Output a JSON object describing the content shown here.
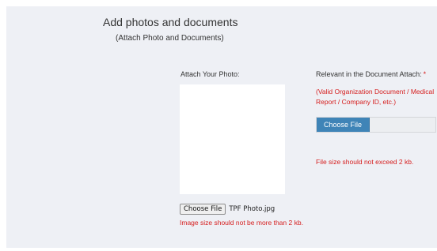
{
  "header": {
    "title": "Add photos and documents",
    "subtitle": "(Attach Photo and Documents)"
  },
  "photo": {
    "label": "Attach Your Photo:",
    "choose_button": "Choose File",
    "file_name": "TPF Photo.jpg",
    "size_error": "Image size should not be more than 2 kb."
  },
  "document": {
    "label": "Relevant in the Document Attach:",
    "required_marker": "*",
    "hint": "(Valid Organization Document / Medical Report / Company ID, etc.)",
    "choose_button": "Choose File",
    "size_error": "File size should not exceed 2 kb."
  },
  "colors": {
    "panel_background": "#eef0f5",
    "error_text": "#d62020",
    "primary_button": "#3f84b7"
  }
}
